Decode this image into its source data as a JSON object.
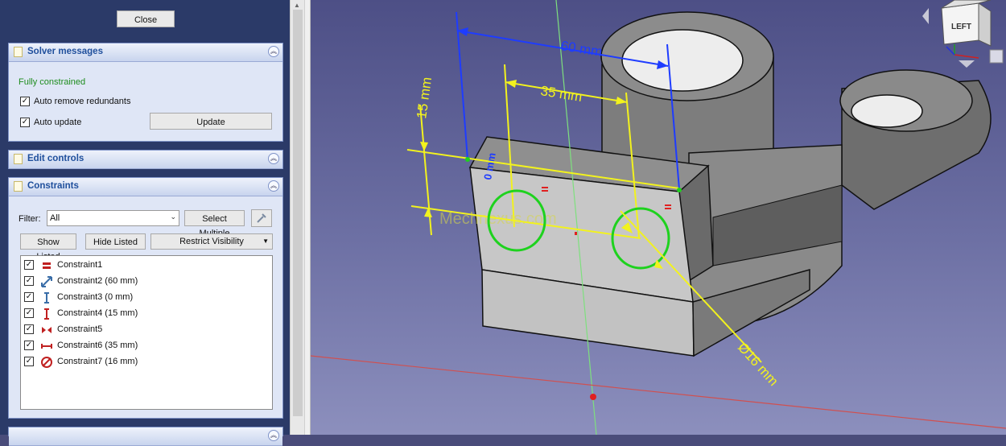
{
  "close_label": "Close",
  "solver": {
    "title": "Solver messages",
    "status": "Fully constrained",
    "auto_remove_label": "Auto remove redundants",
    "auto_update_label": "Auto update",
    "update_label": "Update"
  },
  "edit_controls": {
    "title": "Edit controls"
  },
  "constraints": {
    "title": "Constraints",
    "filter_label": "Filter:",
    "filter_value": "All",
    "select_multiple_label": "Select Multiple",
    "show_listed_label": "Show Listed",
    "hide_listed_label": "Hide Listed",
    "restrict_visibility_label": "Restrict Visibility",
    "items": [
      {
        "label": "Constraint1",
        "icon": "equal-icon"
      },
      {
        "label": "Constraint2 (60 mm)",
        "icon": "distance-icon"
      },
      {
        "label": "Constraint3 (0 mm)",
        "icon": "vertical-distance-icon"
      },
      {
        "label": "Constraint4 (15 mm)",
        "icon": "vertical-distance-icon"
      },
      {
        "label": "Constraint5",
        "icon": "symmetric-icon"
      },
      {
        "label": "Constraint6 (35 mm)",
        "icon": "horizontal-distance-icon"
      },
      {
        "label": "Constraint7 (16 mm)",
        "icon": "diameter-icon"
      }
    ]
  },
  "viewport": {
    "dim_60": "60 mm",
    "dim_35": "35 mm",
    "dim_15": "15 mm",
    "dim_0": "0 mm",
    "dim_d16": "Ø16 mm",
    "watermark": "Mechnexus.com",
    "nav_cube_face": "LEFT"
  },
  "colors": {
    "dimension_yellow": "#f2f21e",
    "selected_blue": "#1e3cff",
    "circle_green": "#1ed21e",
    "axis_green": "#7ee07e",
    "axis_red": "#d05050"
  }
}
